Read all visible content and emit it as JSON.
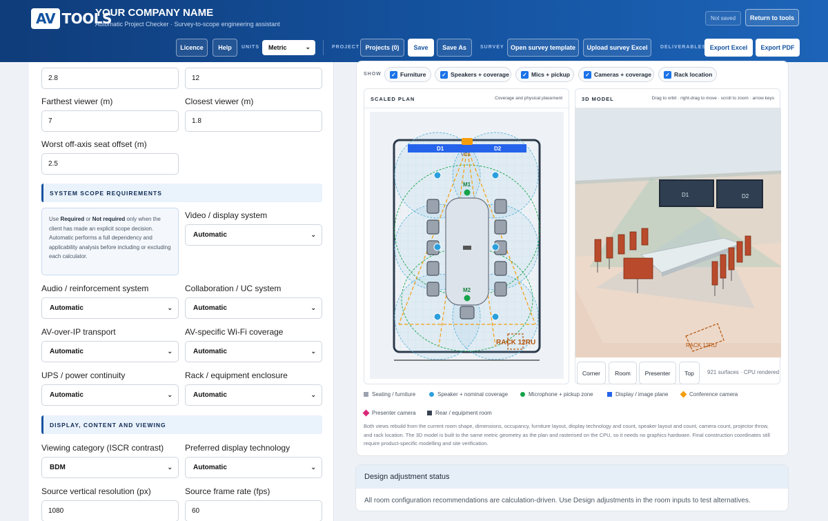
{
  "header": {
    "logo_av": "AV",
    "logo_tools": "TOOLS",
    "company": "YOUR COMPANY NAME",
    "subtitle": "Automatic Project Checker · Survey-to-scope engineering assistant",
    "status": "Not saved",
    "return_label": "Return to tools"
  },
  "toolbar": {
    "licence": "Licence",
    "help": "Help",
    "units_label": "UNITS",
    "units_value": "Metric",
    "project_label": "PROJECT",
    "projects": "Projects (0)",
    "save": "Save",
    "save_as": "Save As",
    "survey_label": "SURVEY",
    "open_survey": "Open survey template",
    "upload_survey": "Upload survey Excel",
    "deliverables_label": "DELIVERABLES",
    "export_excel": "Export Excel",
    "export_pdf": "Export PDF"
  },
  "form": {
    "row0": {
      "left_value": "2.8",
      "right_value": "12"
    },
    "farthest_label": "Farthest viewer (m)",
    "farthest_value": "7",
    "closest_label": "Closest viewer (m)",
    "closest_value": "1.8",
    "offaxis_label": "Worst off-axis seat offset (m)",
    "offaxis_value": "2.5",
    "system_section": "SYSTEM SCOPE REQUIREMENTS",
    "note_prefix": "Use ",
    "note_required": "Required",
    "note_or": " or ",
    "note_not_required": "Not required",
    "note_rest": " only when the client has made an explicit scope decision. Automatic performs a full dependency and applicability analysis before including or excluding each calculator.",
    "video_label": "Video / display system",
    "video_value": "Automatic",
    "audio_label": "Audio / reinforcement system",
    "audio_value": "Automatic",
    "collab_label": "Collaboration / UC system",
    "collab_value": "Automatic",
    "avoip_label": "AV-over-IP transport",
    "avoip_value": "Automatic",
    "wifi_label": "AV-specific Wi-Fi coverage",
    "wifi_value": "Automatic",
    "ups_label": "UPS / power continuity",
    "ups_value": "Automatic",
    "rack_label": "Rack / equipment enclosure",
    "rack_value": "Automatic",
    "display_section": "DISPLAY, CONTENT AND VIEWING",
    "viewing_label": "Viewing category (ISCR contrast)",
    "viewing_value": "BDM",
    "tech_label": "Preferred display technology",
    "tech_value": "Automatic",
    "vres_label": "Source vertical resolution (px)",
    "vres_value": "1080",
    "fps_label": "Source frame rate (fps)",
    "fps_value": "60"
  },
  "show": {
    "label": "SHOW",
    "chips": [
      "Furniture",
      "Speakers + coverage",
      "Mics + pickup",
      "Cameras + coverage",
      "Rack location"
    ]
  },
  "plan": {
    "title": "SCALED PLAN",
    "subtitle": "Coverage and physical placement",
    "d1": "D1",
    "d2": "D2",
    "vc": "VC1",
    "m1": "M1",
    "m2": "M2",
    "rack": "RACK 12RU"
  },
  "model": {
    "title": "3D MODEL",
    "subtitle": "Drag to orbit · right-drag to move · scroll to zoom · arrow keys",
    "d1": "D1",
    "d2": "D2",
    "rack": "RACK 12RU",
    "views": [
      "Corner",
      "Room",
      "Presenter",
      "Top"
    ],
    "surfaces": "921 surfaces · CPU rendered"
  },
  "legend": [
    {
      "label": "Seating / furniture",
      "color": "#9ca3af",
      "shape": "square"
    },
    {
      "label": "Speaker + nominal coverage",
      "color": "#2b9fdc",
      "shape": "circle"
    },
    {
      "label": "Microphone + pickup zone",
      "color": "#16a34a",
      "shape": "circle"
    },
    {
      "label": "Display / image plane",
      "color": "#2563eb",
      "shape": "square"
    },
    {
      "label": "Conference camera",
      "color": "#f59e0b",
      "shape": "diamond"
    },
    {
      "label": "Presenter camera",
      "color": "#db2777",
      "shape": "diamond"
    },
    {
      "label": "Rear / equipment room",
      "color": "#374151",
      "shape": "square"
    }
  ],
  "description": "Both views rebuild from the current room shape, dimensions, occupancy, furniture layout, display technology and count, speaker layout and count, camera count, projector throw, and rack location. The 3D model is built to the same metric geometry as the plan and rasterised on the CPU, so it needs no graphics hardware. Final construction coordinates still require product-specific modelling and site verification.",
  "adjustment": {
    "title": "Design adjustment status",
    "body": "All room configuration recommendations are calculation-driven. Use Design adjustments in the room inputs to test alternatives."
  }
}
